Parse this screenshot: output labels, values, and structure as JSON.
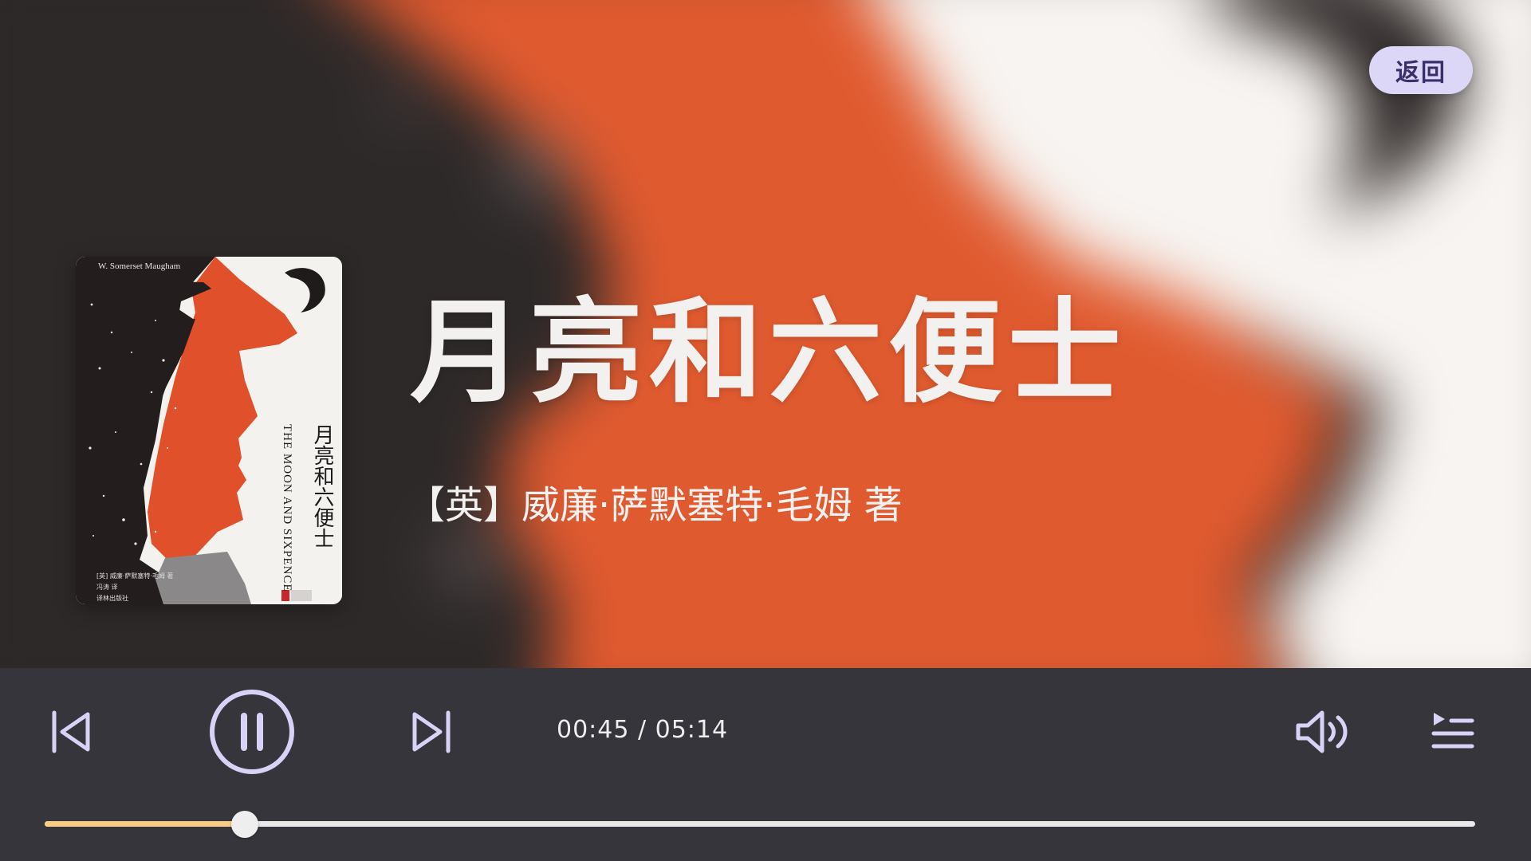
{
  "header": {
    "back_label": "返回"
  },
  "book": {
    "title": "月亮和六便士",
    "author_line": "【英】威廉·萨默塞特·毛姆 著",
    "cover": {
      "author_en": "W. Somerset Maugham",
      "title_cn": "月亮和六便士",
      "title_en": "THE MOON AND SIXPENCE",
      "author_cn": "[英] 威廉·萨默塞特·毛姆 著",
      "translator": "冯涛 译",
      "publisher": "译林出版社"
    }
  },
  "player": {
    "current_time": "00:45",
    "total_time": "05:14",
    "time_display": "00:45 / 05:14",
    "progress": 0.14,
    "icons": {
      "prev": "skip-previous-icon",
      "pause": "pause-icon",
      "next": "skip-next-icon",
      "volume": "volume-icon",
      "playlist": "playlist-icon"
    }
  },
  "colors": {
    "accent": "#d8d2f7",
    "progress_fill": "#f7cd86",
    "bar_background": "#36353c",
    "cover_orange": "#e0522a"
  }
}
